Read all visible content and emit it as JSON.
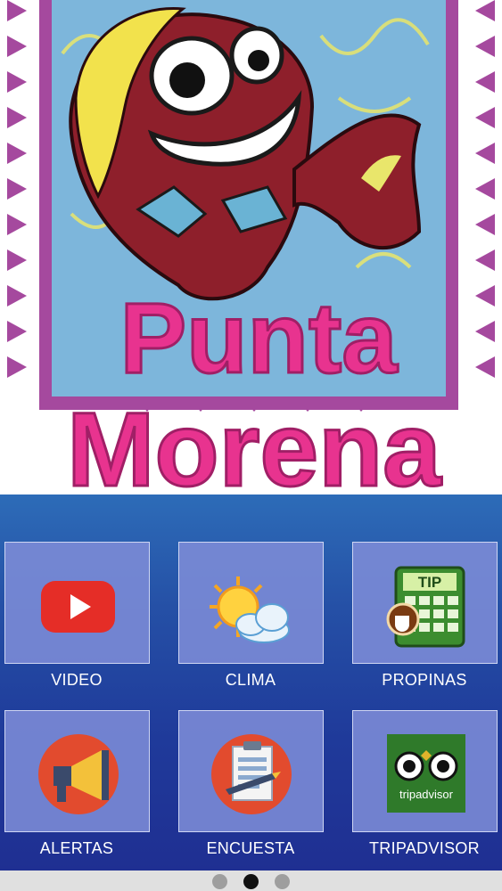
{
  "logo": {
    "text_line1": "Punta",
    "text_line2": "Morena",
    "colors": {
      "border": "#a5499e",
      "background": "#79b3d8",
      "fish": "#8e1f2b",
      "text": "#e8338f"
    }
  },
  "menu": {
    "items": [
      {
        "label": "VIDEO",
        "icon": "youtube-icon"
      },
      {
        "label": "CLIMA",
        "icon": "weather-icon"
      },
      {
        "label": "PROPINAS",
        "icon": "tip-calculator-icon",
        "icon_text": "TIP"
      },
      {
        "label": "ALERTAS",
        "icon": "megaphone-icon"
      },
      {
        "label": "ENCUESTA",
        "icon": "survey-icon"
      },
      {
        "label": "TRIPADVISOR",
        "icon": "tripadvisor-icon",
        "icon_text": "tripadvisor"
      }
    ]
  },
  "pager": {
    "pages": 3,
    "active_index": 1
  }
}
